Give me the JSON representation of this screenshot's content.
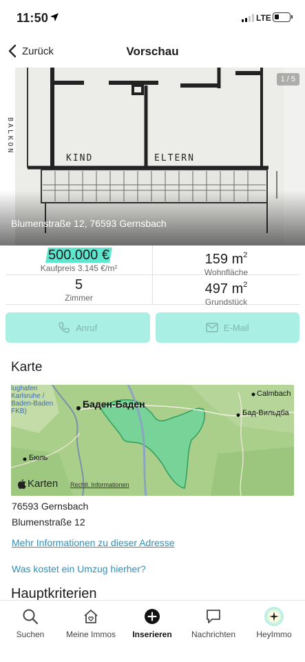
{
  "status_bar": {
    "time": "11:50",
    "network": "LTE"
  },
  "nav": {
    "back_label": "Zurück",
    "title": "Vorschau"
  },
  "hero": {
    "address": "Blumenstraße 12, 76593 Gernsbach",
    "counter": "1 / 5",
    "plan_labels": {
      "kind": "KIND",
      "eltern": "ELTERN",
      "balkon": "BALKON"
    }
  },
  "facts": {
    "price": {
      "value": "500.000 €",
      "label": "Kaufpreis 3.145 €/m²"
    },
    "living_area": {
      "value": "159 m",
      "sup": "2",
      "label": "Wohnfläche"
    },
    "rooms": {
      "value": "5",
      "label": "Zimmer"
    },
    "plot_area": {
      "value": "497 m",
      "sup": "2",
      "label": "Grundstück"
    }
  },
  "contact": {
    "call_label": "Anruf",
    "email_label": "E-Mail"
  },
  "map_section": {
    "title": "Karte",
    "labels": {
      "baden_baden": "Баден-Баден",
      "calmbach": "Calmbach",
      "bad_wildbad": "Бад-Вильдба",
      "buehl": "Бюль",
      "airport": [
        "lughafen",
        "Karlsruhe /",
        "Baden-Baden",
        "FKB)"
      ]
    },
    "apple_maps": "Karten",
    "legal": "Rechtl. Informationen"
  },
  "address": {
    "line1": "76593 Gernsbach",
    "line2": "Blumenstraße 12"
  },
  "links": {
    "more_info": "Mehr Informationen zu dieser Adresse",
    "moving_cost": "Was kostet ein Umzug hierher?"
  },
  "criteria": {
    "title": "Hauptkriterien"
  },
  "tabs": [
    {
      "label": "Suchen",
      "icon": "search-icon"
    },
    {
      "label": "Meine Immos",
      "icon": "house-heart-icon"
    },
    {
      "label": "Inserieren",
      "icon": "plus-circle-icon"
    },
    {
      "label": "Nachrichten",
      "icon": "chat-bubble-icon"
    },
    {
      "label": "HeyImmo",
      "icon": "sparkle-icon"
    }
  ],
  "colors": {
    "accent": "#5fe6cf",
    "button_bg": "#a9efe3",
    "link": "#2f8fb9",
    "map_area": "#6ed49a"
  }
}
